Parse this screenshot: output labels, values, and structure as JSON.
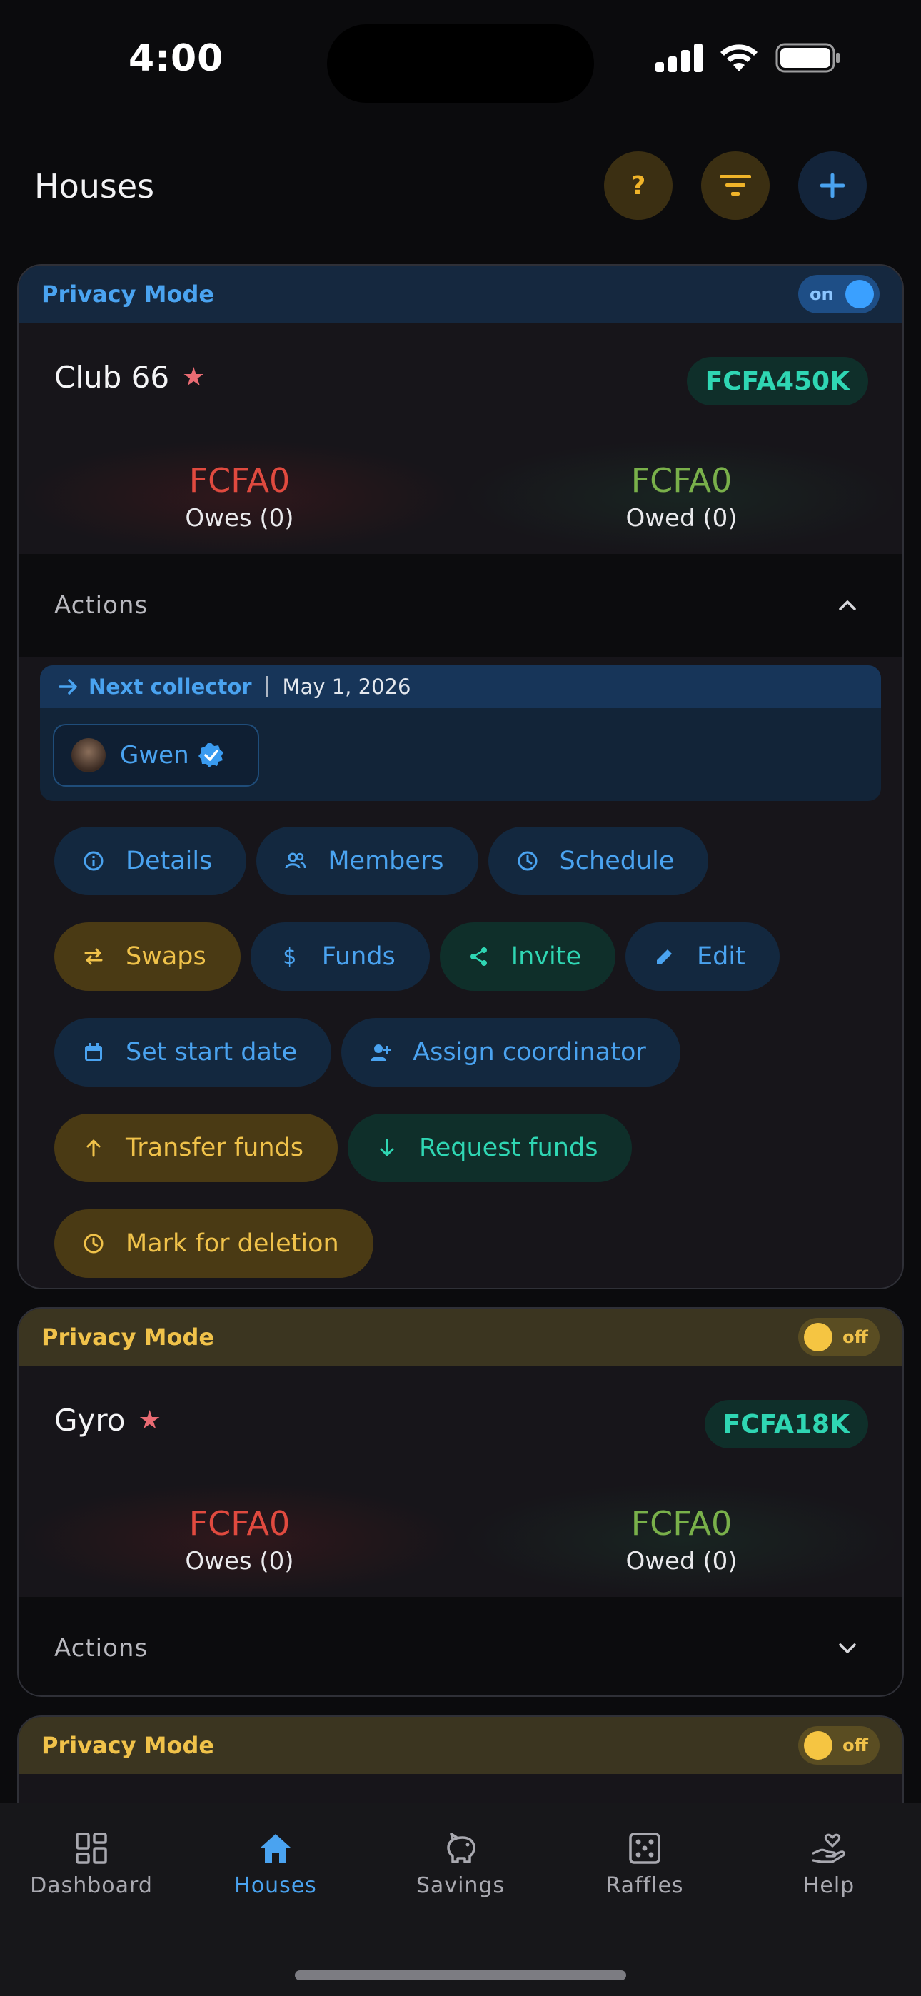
{
  "status_bar": {
    "time": "4:00"
  },
  "header": {
    "title": "Houses",
    "help_label": "?"
  },
  "houses": [
    {
      "privacy_label": "Privacy Mode",
      "privacy_state": "on",
      "name": "Club 66",
      "amount": "FCFA450K",
      "owes_value": "FCFA0",
      "owes_label": "Owes (0)",
      "owed_value": "FCFA0",
      "owed_label": "Owed (0)",
      "actions_label": "Actions",
      "next_collector_label": "Next collector",
      "next_collector_date": "May 1, 2026",
      "collector_name": "Gwen",
      "buttons": {
        "details": "Details",
        "members": "Members",
        "schedule": "Schedule",
        "swaps": "Swaps",
        "funds": "Funds",
        "invite": "Invite",
        "edit": "Edit",
        "set_start_date": "Set start date",
        "assign_coordinator": "Assign coordinator",
        "transfer_funds": "Transfer funds",
        "request_funds": "Request funds",
        "mark_for_deletion": "Mark for deletion"
      }
    },
    {
      "privacy_label": "Privacy Mode",
      "privacy_state": "off",
      "name": "Gyro",
      "amount": "FCFA18K",
      "owes_value": "FCFA0",
      "owes_label": "Owes (0)",
      "owed_value": "FCFA0",
      "owed_label": "Owed (0)",
      "actions_label": "Actions"
    },
    {
      "privacy_label": "Privacy Mode",
      "privacy_state": "off"
    }
  ],
  "nav": {
    "items": [
      {
        "label": "Dashboard",
        "icon": "dashboard-icon"
      },
      {
        "label": "Houses",
        "icon": "home-icon"
      },
      {
        "label": "Savings",
        "icon": "piggy-bank-icon"
      },
      {
        "label": "Raffles",
        "icon": "dice-icon"
      },
      {
        "label": "Help",
        "icon": "help-heart-icon"
      }
    ],
    "active": "Houses"
  },
  "colors": {
    "accent_blue": "#4aa3f0",
    "accent_gold": "#f0c24a",
    "accent_teal": "#2fd6b3",
    "owes_red": "#e04a3f",
    "owed_green": "#79b04a"
  }
}
